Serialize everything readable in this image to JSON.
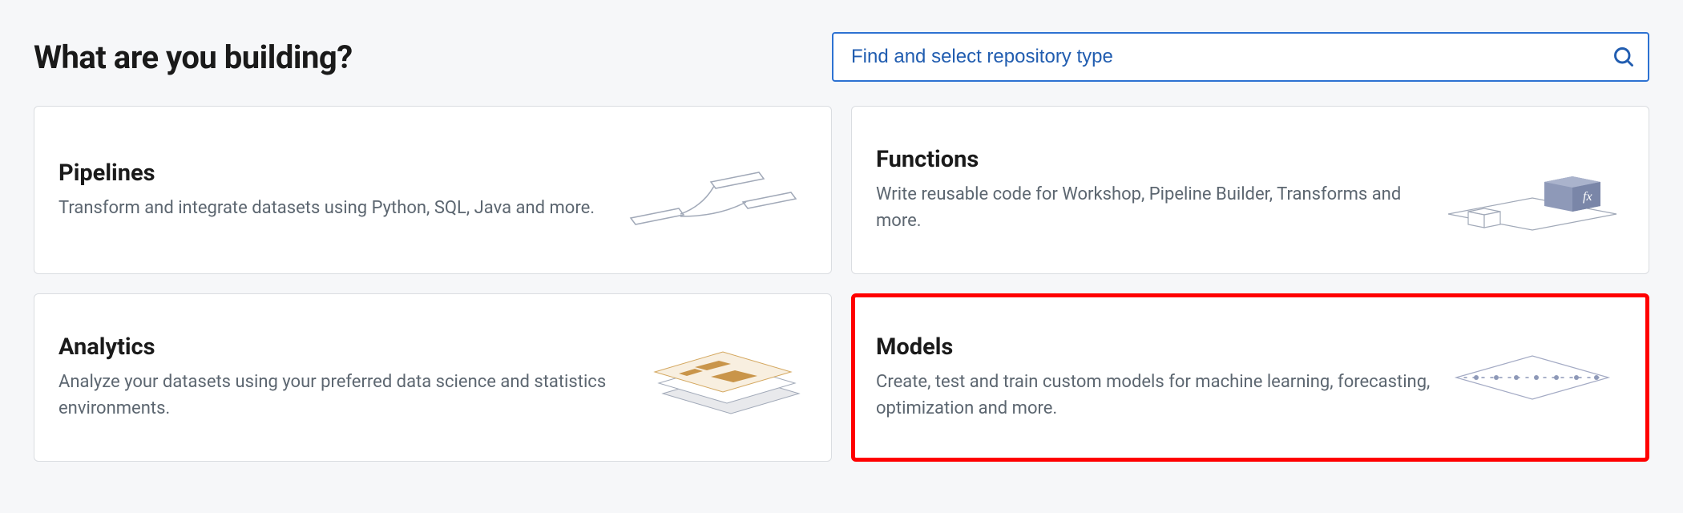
{
  "header": {
    "title": "What are you building?"
  },
  "search": {
    "placeholder": "Find and select repository type"
  },
  "cards": [
    {
      "id": "pipelines",
      "title": "Pipelines",
      "description": "Transform and integrate datasets using Python, SQL, Java and more.",
      "highlighted": false
    },
    {
      "id": "functions",
      "title": "Functions",
      "description": "Write reusable code for Workshop, Pipeline Builder, Transforms and more.",
      "highlighted": false
    },
    {
      "id": "analytics",
      "title": "Analytics",
      "description": "Analyze your datasets using your preferred data science and statistics environments.",
      "highlighted": false
    },
    {
      "id": "models",
      "title": "Models",
      "description": "Create, test and train custom models for machine learning, forecasting, optimization and more.",
      "highlighted": true
    }
  ]
}
